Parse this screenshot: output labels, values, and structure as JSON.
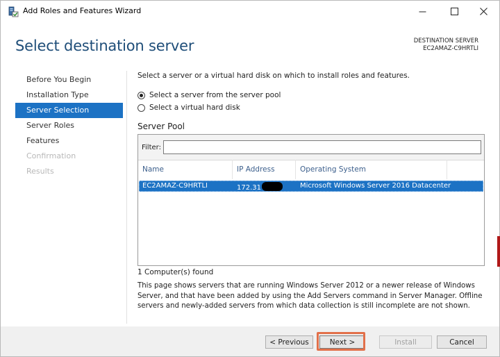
{
  "window": {
    "title": "Add Roles and Features Wizard",
    "icon": "server-manager-wizard-icon",
    "controls": [
      "minimize-icon",
      "maximize-icon",
      "close-icon"
    ]
  },
  "header": {
    "page_title": "Select destination server",
    "destination_label": "DESTINATION SERVER",
    "destination_server": "EC2AMAZ-C9HRTLI"
  },
  "nav": {
    "items": [
      {
        "label": "Before You Begin",
        "state": "normal"
      },
      {
        "label": "Installation Type",
        "state": "normal"
      },
      {
        "label": "Server Selection",
        "state": "active"
      },
      {
        "label": "Server Roles",
        "state": "normal"
      },
      {
        "label": "Features",
        "state": "normal"
      },
      {
        "label": "Confirmation",
        "state": "disabled"
      },
      {
        "label": "Results",
        "state": "disabled"
      }
    ]
  },
  "content": {
    "instruction": "Select a server or a virtual hard disk on which to install roles and features.",
    "options": [
      {
        "label": "Select a server from the server pool",
        "checked": true
      },
      {
        "label": "Select a virtual hard disk",
        "checked": false
      }
    ],
    "server_pool": {
      "title": "Server Pool",
      "filter_label": "Filter:",
      "filter_value": "",
      "columns": [
        "Name",
        "IP Address",
        "Operating System"
      ],
      "rows": [
        {
          "name": "EC2AMAZ-C9HRTLI",
          "ip": "172.31",
          "os": "Microsoft Windows Server 2016 Datacenter",
          "selected": true
        }
      ]
    },
    "count_text": "1 Computer(s) found",
    "description": "This page shows servers that are running Windows Server 2012 or a newer release of Windows Server, and that have been added by using the Add Servers command in Server Manager. Offline servers and newly-added servers from which data collection is still incomplete are not shown."
  },
  "footer": {
    "previous": "< Previous",
    "next": "Next >",
    "install": "Install",
    "cancel": "Cancel"
  },
  "colors": {
    "accent": "#1c72c4",
    "title": "#1f4e79",
    "highlight": "#e2704a"
  }
}
